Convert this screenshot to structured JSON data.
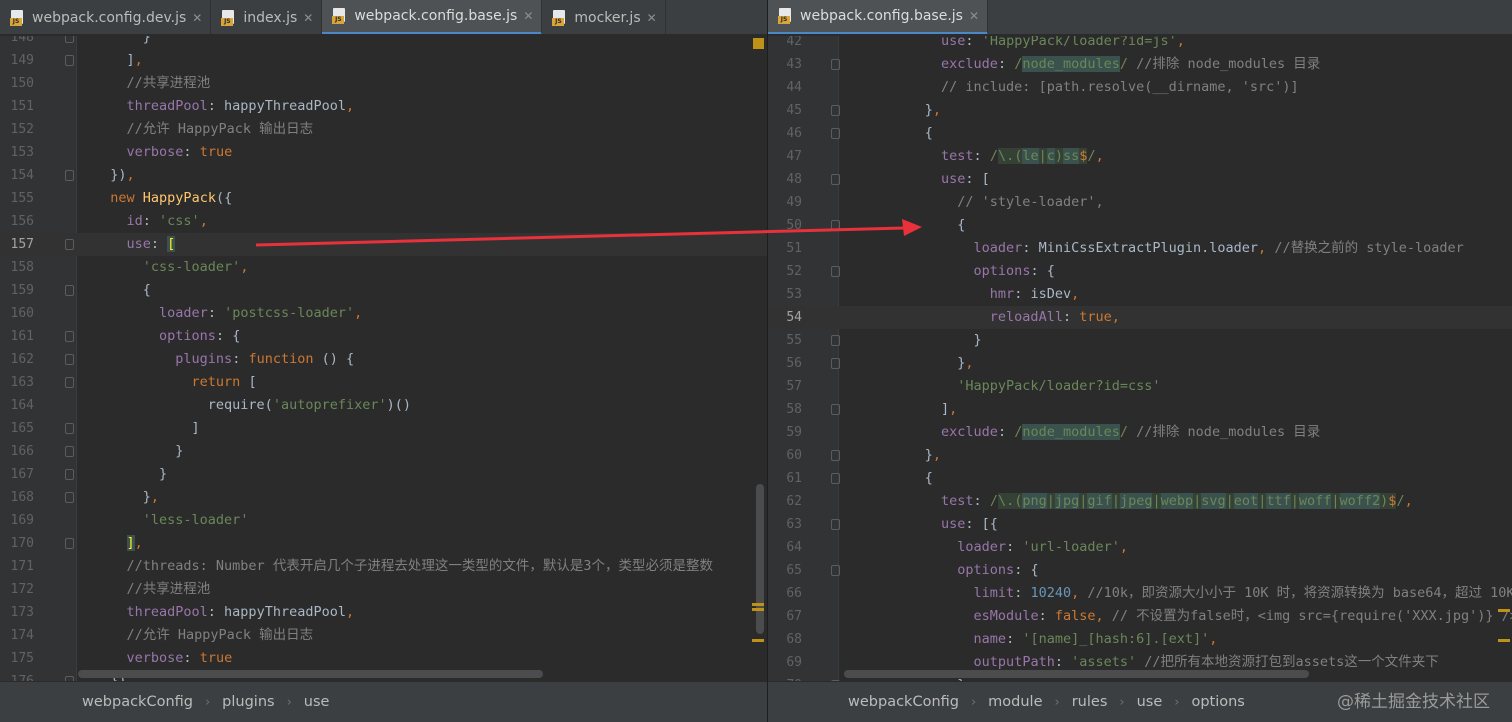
{
  "left_tabs": [
    {
      "label": "webpack.config.dev.js",
      "icon": "js-file-icon",
      "active": false
    },
    {
      "label": "index.js",
      "icon": "js-file-icon",
      "active": false
    },
    {
      "label": "webpack.config.base.js",
      "icon": "js-file-icon",
      "active": true
    },
    {
      "label": "mocker.js",
      "icon": "js-file-icon",
      "active": false
    }
  ],
  "right_tabs": [
    {
      "label": "webpack.config.base.js",
      "icon": "js-file-icon",
      "active": true
    }
  ],
  "left_breadcrumbs": [
    "webpackConfig",
    "plugins",
    "use"
  ],
  "right_breadcrumbs": [
    "webpackConfig",
    "module",
    "rules",
    "use",
    "options"
  ],
  "watermark": "@稀土掘金技术社区",
  "left_current_line": "157",
  "right_current_line": "54",
  "left_lines": [
    {
      "n": "148",
      "t": "      }"
    },
    {
      "n": "149",
      "t": "    ],"
    },
    {
      "n": "150",
      "t": "    //共享进程池"
    },
    {
      "n": "151",
      "t": "    threadPool: happyThreadPool,"
    },
    {
      "n": "152",
      "t": "    //允许 HappyPack 输出日志"
    },
    {
      "n": "153",
      "t": "    verbose: true"
    },
    {
      "n": "154",
      "t": "  }),"
    },
    {
      "n": "155",
      "t": "  new HappyPack({"
    },
    {
      "n": "156",
      "t": "    id: 'css',"
    },
    {
      "n": "157",
      "t": "    use: ["
    },
    {
      "n": "158",
      "t": "      'css-loader',"
    },
    {
      "n": "159",
      "t": "      {"
    },
    {
      "n": "160",
      "t": "        loader: 'postcss-loader',"
    },
    {
      "n": "161",
      "t": "        options: {"
    },
    {
      "n": "162",
      "t": "          plugins: function () {"
    },
    {
      "n": "163",
      "t": "            return ["
    },
    {
      "n": "164",
      "t": "              require('autoprefixer')()"
    },
    {
      "n": "165",
      "t": "            ]"
    },
    {
      "n": "166",
      "t": "          }"
    },
    {
      "n": "167",
      "t": "        }"
    },
    {
      "n": "168",
      "t": "      },"
    },
    {
      "n": "169",
      "t": "      'less-loader'"
    },
    {
      "n": "170",
      "t": "    ],"
    },
    {
      "n": "171",
      "t": "    //threads: Number 代表开启几个子进程去处理这一类型的文件，默认是3个，类型必须是整数"
    },
    {
      "n": "172",
      "t": "    //共享进程池"
    },
    {
      "n": "173",
      "t": "    threadPool: happyThreadPool,"
    },
    {
      "n": "174",
      "t": "    //允许 HappyPack 输出日志"
    },
    {
      "n": "175",
      "t": "    verbose: true"
    },
    {
      "n": "176",
      "t": "  })"
    }
  ],
  "right_lines": [
    {
      "n": "42",
      "t": "        use: 'HappyPack/loader?id=js',"
    },
    {
      "n": "43",
      "t": "        exclude: /node_modules/ //排除 node_modules 目录"
    },
    {
      "n": "44",
      "t": "        // include: [path.resolve(__dirname, 'src')]"
    },
    {
      "n": "45",
      "t": "      },"
    },
    {
      "n": "46",
      "t": "      {"
    },
    {
      "n": "47",
      "t": "        test: /\\.(le|c)ss$/,"
    },
    {
      "n": "48",
      "t": "        use: ["
    },
    {
      "n": "49",
      "t": "          // 'style-loader',"
    },
    {
      "n": "50",
      "t": "          {"
    },
    {
      "n": "51",
      "t": "            loader: MiniCssExtractPlugin.loader, //替换之前的 style-loader"
    },
    {
      "n": "52",
      "t": "            options: {"
    },
    {
      "n": "53",
      "t": "              hmr: isDev,"
    },
    {
      "n": "54",
      "t": "              reloadAll: true,"
    },
    {
      "n": "55",
      "t": "            }"
    },
    {
      "n": "56",
      "t": "          },"
    },
    {
      "n": "57",
      "t": "          'HappyPack/loader?id=css'"
    },
    {
      "n": "58",
      "t": "        ],"
    },
    {
      "n": "59",
      "t": "        exclude: /node_modules/ //排除 node_modules 目录"
    },
    {
      "n": "60",
      "t": "      },"
    },
    {
      "n": "61",
      "t": "      {"
    },
    {
      "n": "62",
      "t": "        test: /\\.(png|jpg|gif|jpeg|webp|svg|eot|ttf|woff|woff2)$/,"
    },
    {
      "n": "63",
      "t": "        use: [{"
    },
    {
      "n": "64",
      "t": "          loader: 'url-loader',"
    },
    {
      "n": "65",
      "t": "          options: {"
    },
    {
      "n": "66",
      "t": "            limit: 10240, //10k，即资源大小小于 10K 时，将资源转换为 base64，超过 10K"
    },
    {
      "n": "67",
      "t": "            esModule: false, // 不设置为false时，<img src={require('XXX.jpg')} /> 会"
    },
    {
      "n": "68",
      "t": "            name: '[name]_[hash:6].[ext]',"
    },
    {
      "n": "69",
      "t": "            outputPath: 'assets' //把所有本地资源打包到assets这一个文件夹下"
    },
    {
      "n": "70",
      "t": "          }"
    }
  ],
  "colors": {
    "editor_bg": "#2b2b2b",
    "keyword": "#cc7832",
    "string": "#6a8759",
    "property": "#9876aa",
    "number": "#6897bb",
    "comment": "#808080",
    "function": "#ffc66d",
    "arrow": "#e8313a"
  }
}
